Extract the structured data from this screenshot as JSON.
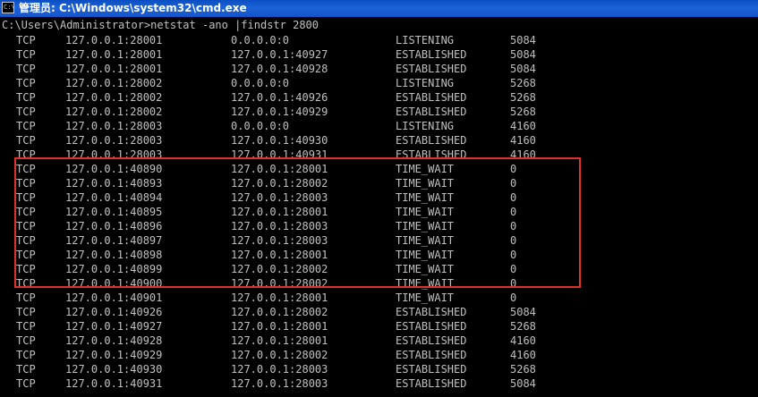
{
  "window": {
    "title": "管理员: C:\\Windows\\system32\\cmd.exe",
    "icon": "cmd-icon",
    "icon_glyph": "C:\\"
  },
  "console": {
    "command": "C:\\Users\\Administrator>netstat -ano |findstr 2800",
    "rows": [
      {
        "proto": "TCP",
        "local": "127.0.0.1:28001",
        "foreign": "0.0.0.0:0",
        "state": "LISTENING",
        "pid": "5084"
      },
      {
        "proto": "TCP",
        "local": "127.0.0.1:28001",
        "foreign": "127.0.0.1:40927",
        "state": "ESTABLISHED",
        "pid": "5084"
      },
      {
        "proto": "TCP",
        "local": "127.0.0.1:28001",
        "foreign": "127.0.0.1:40928",
        "state": "ESTABLISHED",
        "pid": "5084"
      },
      {
        "proto": "TCP",
        "local": "127.0.0.1:28002",
        "foreign": "0.0.0.0:0",
        "state": "LISTENING",
        "pid": "5268"
      },
      {
        "proto": "TCP",
        "local": "127.0.0.1:28002",
        "foreign": "127.0.0.1:40926",
        "state": "ESTABLISHED",
        "pid": "5268"
      },
      {
        "proto": "TCP",
        "local": "127.0.0.1:28002",
        "foreign": "127.0.0.1:40929",
        "state": "ESTABLISHED",
        "pid": "5268"
      },
      {
        "proto": "TCP",
        "local": "127.0.0.1:28003",
        "foreign": "0.0.0.0:0",
        "state": "LISTENING",
        "pid": "4160"
      },
      {
        "proto": "TCP",
        "local": "127.0.0.1:28003",
        "foreign": "127.0.0.1:40930",
        "state": "ESTABLISHED",
        "pid": "4160"
      },
      {
        "proto": "TCP",
        "local": "127.0.0.1:28003",
        "foreign": "127.0.0.1:40931",
        "state": "ESTABLISHED",
        "pid": "4160"
      },
      {
        "proto": "TCP",
        "local": "127.0.0.1:40890",
        "foreign": "127.0.0.1:28001",
        "state": "TIME_WAIT",
        "pid": "0"
      },
      {
        "proto": "TCP",
        "local": "127.0.0.1:40893",
        "foreign": "127.0.0.1:28002",
        "state": "TIME_WAIT",
        "pid": "0"
      },
      {
        "proto": "TCP",
        "local": "127.0.0.1:40894",
        "foreign": "127.0.0.1:28003",
        "state": "TIME_WAIT",
        "pid": "0"
      },
      {
        "proto": "TCP",
        "local": "127.0.0.1:40895",
        "foreign": "127.0.0.1:28001",
        "state": "TIME_WAIT",
        "pid": "0"
      },
      {
        "proto": "TCP",
        "local": "127.0.0.1:40896",
        "foreign": "127.0.0.1:28003",
        "state": "TIME_WAIT",
        "pid": "0"
      },
      {
        "proto": "TCP",
        "local": "127.0.0.1:40897",
        "foreign": "127.0.0.1:28003",
        "state": "TIME_WAIT",
        "pid": "0"
      },
      {
        "proto": "TCP",
        "local": "127.0.0.1:40898",
        "foreign": "127.0.0.1:28001",
        "state": "TIME_WAIT",
        "pid": "0"
      },
      {
        "proto": "TCP",
        "local": "127.0.0.1:40899",
        "foreign": "127.0.0.1:28002",
        "state": "TIME_WAIT",
        "pid": "0"
      },
      {
        "proto": "TCP",
        "local": "127.0.0.1:40900",
        "foreign": "127.0.0.1:28002",
        "state": "TIME_WAIT",
        "pid": "0"
      },
      {
        "proto": "TCP",
        "local": "127.0.0.1:40901",
        "foreign": "127.0.0.1:28001",
        "state": "TIME_WAIT",
        "pid": "0"
      },
      {
        "proto": "TCP",
        "local": "127.0.0.1:40926",
        "foreign": "127.0.0.1:28002",
        "state": "ESTABLISHED",
        "pid": "5084"
      },
      {
        "proto": "TCP",
        "local": "127.0.0.1:40927",
        "foreign": "127.0.0.1:28001",
        "state": "ESTABLISHED",
        "pid": "5268"
      },
      {
        "proto": "TCP",
        "local": "127.0.0.1:40928",
        "foreign": "127.0.0.1:28001",
        "state": "ESTABLISHED",
        "pid": "4160"
      },
      {
        "proto": "TCP",
        "local": "127.0.0.1:40929",
        "foreign": "127.0.0.1:28002",
        "state": "ESTABLISHED",
        "pid": "4160"
      },
      {
        "proto": "TCP",
        "local": "127.0.0.1:40930",
        "foreign": "127.0.0.1:28003",
        "state": "ESTABLISHED",
        "pid": "5268"
      },
      {
        "proto": "TCP",
        "local": "127.0.0.1:40931",
        "foreign": "127.0.0.1:28003",
        "state": "ESTABLISHED",
        "pid": "5084"
      }
    ]
  },
  "annotation": {
    "color": "#e0322c",
    "highlighted_state": "TIME_WAIT"
  },
  "colors": {
    "titlebar": "#1c62d8",
    "console_background": "#000000",
    "console_text": "#c0c0c0"
  }
}
